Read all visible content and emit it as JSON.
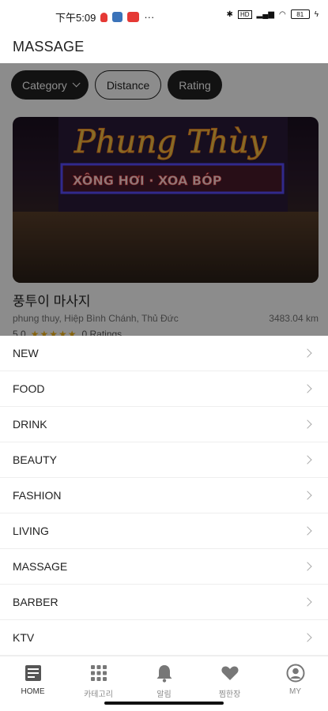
{
  "status": {
    "time": "下午5:09",
    "dots": "···",
    "battery": "81"
  },
  "header": {
    "title": "MASSAGE"
  },
  "filters": {
    "category": "Category",
    "distance": "Distance",
    "rating": "Rating"
  },
  "card": {
    "title": "풍투이 마사지",
    "address": "phung thuy, Hiệp Bình Chánh, Thủ Đức",
    "distance": "3483.04 km",
    "score": "5.0",
    "stars": "★★★★★",
    "ratings": "0 Ratings",
    "sign_main": "Phung Thùy",
    "sign_sub": "XÔNG HƠI · XOA BÓP"
  },
  "menu": [
    {
      "label": "NEW"
    },
    {
      "label": "FOOD"
    },
    {
      "label": "DRINK"
    },
    {
      "label": "BEAUTY"
    },
    {
      "label": "FASHION"
    },
    {
      "label": "LIVING"
    },
    {
      "label": "MASSAGE"
    },
    {
      "label": "BARBER"
    },
    {
      "label": "KTV"
    }
  ],
  "tabs": {
    "home": "HOME",
    "category": "카테고리",
    "alarm": "알림",
    "wishlist": "찜한장",
    "my": "MY"
  },
  "colors": {
    "star": "#f2b51b",
    "overlay": "rgba(0,0,0,0.45)"
  }
}
